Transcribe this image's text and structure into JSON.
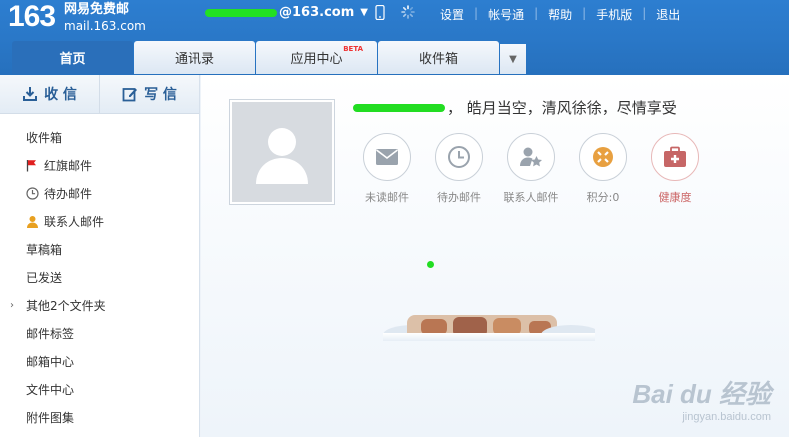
{
  "header": {
    "logo_number": "163",
    "logo_line1": "网易免费邮",
    "logo_line2": "mail.163.com",
    "account_suffix": "@163.com",
    "links": [
      "设置",
      "帐号通",
      "帮助",
      "手机版",
      "退出"
    ]
  },
  "tabs": [
    {
      "label": "首页",
      "active": true
    },
    {
      "label": "通讯录"
    },
    {
      "label": "应用中心",
      "badge": "BETA"
    },
    {
      "label": "收件箱"
    }
  ],
  "sidebar": {
    "receive_label": "收 信",
    "compose_label": "写 信",
    "folders": [
      {
        "label": "收件箱"
      },
      {
        "label": "红旗邮件",
        "icon": "red-flag-icon"
      },
      {
        "label": "待办邮件",
        "icon": "clock-icon"
      },
      {
        "label": "联系人邮件",
        "icon": "contact-icon"
      },
      {
        "label": "草稿箱"
      },
      {
        "label": "已发送"
      },
      {
        "label": "其他2个文件夹",
        "icon": "chevron-right-icon"
      },
      {
        "label": "邮件标签"
      },
      {
        "label": "邮箱中心"
      },
      {
        "label": "文件中心"
      },
      {
        "label": "附件图集"
      }
    ]
  },
  "main": {
    "greeting": "，  皓月当空，清风徐徐，尽情享受",
    "quick": [
      {
        "label": "未读邮件",
        "icon": "envelope-icon"
      },
      {
        "label": "待办邮件",
        "icon": "clock-icon"
      },
      {
        "label": "联系人邮件",
        "icon": "contact-star-icon"
      },
      {
        "label": "积分:0",
        "icon": "points-icon"
      },
      {
        "label": "健康度",
        "icon": "health-kit-icon"
      }
    ],
    "watermark": "Bai du 经验",
    "watermark_sub": "jingyan.baidu.com"
  },
  "colors": {
    "header_blue": "#2a78c8",
    "tab_active": "#2a6fba",
    "mask_green": "#22dd22",
    "flag_red": "#e02020",
    "points_orange": "#e8a040",
    "health_red": "#c66666"
  }
}
